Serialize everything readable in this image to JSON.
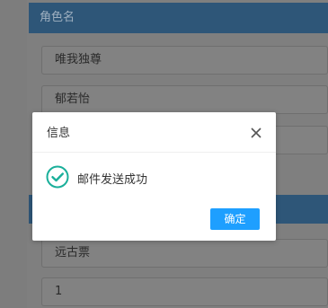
{
  "background_form": {
    "section_header": "角色名",
    "fields": [
      {
        "value": "唯我独尊"
      },
      {
        "value": "郁若怡"
      },
      {
        "value": ""
      },
      {
        "value": "远古票"
      },
      {
        "value": "1"
      }
    ]
  },
  "dialog": {
    "title": "信息",
    "close_icon": "close-icon",
    "status_icon": "success-check-icon",
    "message": "邮件发送成功",
    "ok_label": "确定"
  },
  "colors": {
    "header_blue": "#2e5678",
    "button_blue": "#1e9fff",
    "success_teal": "#1aaf9a",
    "overlay_gray": "#7f7f7f"
  }
}
